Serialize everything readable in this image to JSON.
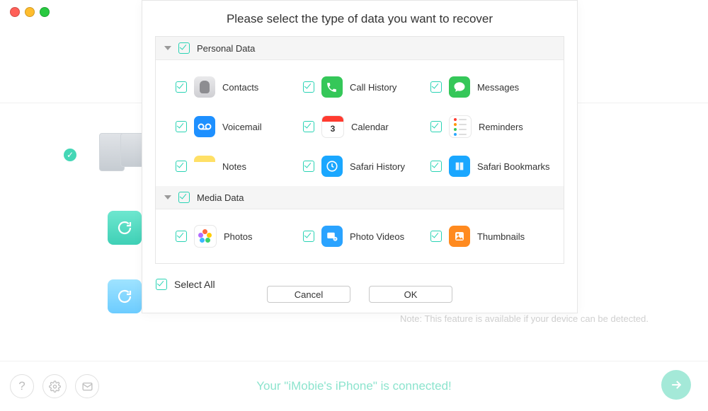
{
  "modal": {
    "title": "Please select the type of data you want to recover",
    "sections": [
      {
        "title": "Personal Data",
        "items": [
          {
            "label": "Contacts"
          },
          {
            "label": "Call History"
          },
          {
            "label": "Messages"
          },
          {
            "label": "Voicemail"
          },
          {
            "label": "Calendar"
          },
          {
            "label": "Reminders"
          },
          {
            "label": "Notes"
          },
          {
            "label": "Safari History"
          },
          {
            "label": "Safari Bookmarks"
          }
        ]
      },
      {
        "title": "Media Data",
        "items": [
          {
            "label": "Photos"
          },
          {
            "label": "Photo Videos"
          },
          {
            "label": "Thumbnails"
          }
        ]
      }
    ],
    "select_all": "Select All",
    "cancel": "Cancel",
    "ok": "OK"
  },
  "note": "Note: This feature is available if your device can be detected.",
  "footer": {
    "status": "Your \"iMobie's iPhone\" is connected!"
  }
}
